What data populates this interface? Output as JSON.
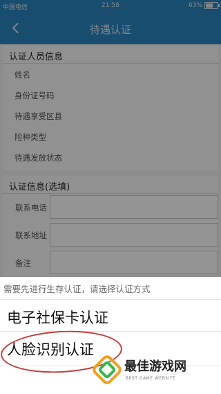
{
  "status_bar": {
    "carrier": "中国电信",
    "time": "21:58",
    "battery": "63%",
    "battery_level": 0.63
  },
  "nav": {
    "title": "待遇认证"
  },
  "section_person": {
    "header": "认证人员信息",
    "fields": [
      "姓名",
      "身份证号码",
      "待遇享受区县",
      "险种类型",
      "待遇发放状态"
    ]
  },
  "section_contact": {
    "header": "认证信息(选填)",
    "fields": [
      "联系电话",
      "联系地址",
      "备注"
    ]
  },
  "sheet": {
    "prompt": "需要先进行生存认证，请选择认证方式",
    "options": [
      "电子社保卡认证",
      "人脸识别认证"
    ]
  },
  "watermark": {
    "title": "最佳游戏网",
    "subtitle": "BEST GAME WEBSITE"
  },
  "colors": {
    "primary": "#2a86c0",
    "highlight_circle": "#c83a3a"
  }
}
